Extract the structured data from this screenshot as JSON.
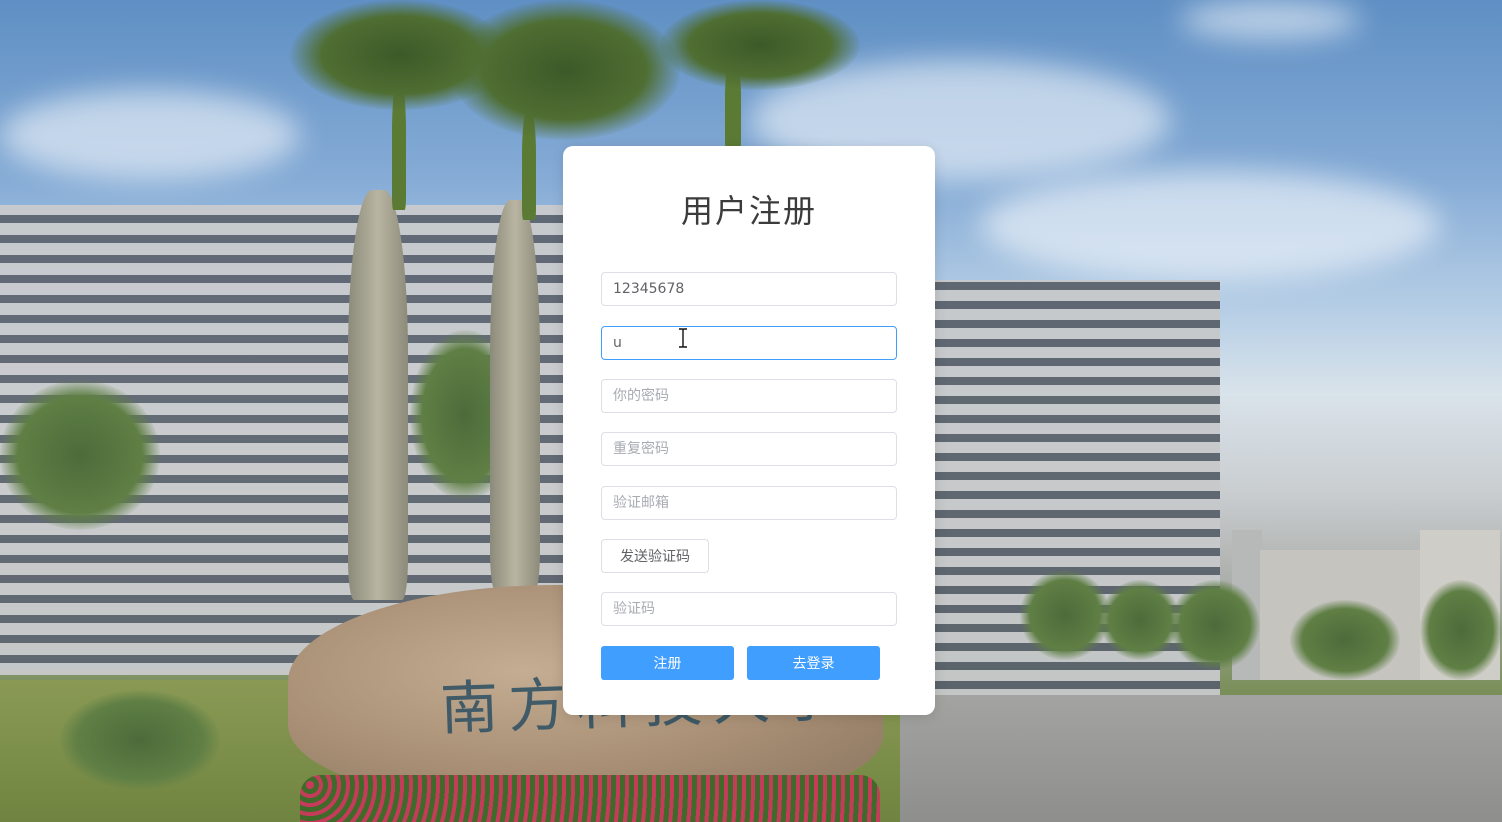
{
  "register_card": {
    "title": "用户注册",
    "student_id_value": "12345678",
    "username_value": "u",
    "password_placeholder": "你的密码",
    "repeat_password_placeholder": "重复密码",
    "email_placeholder": "验证邮箱",
    "send_code_label": "发送验证码",
    "code_placeholder": "验证码",
    "register_label": "注册",
    "goto_login_label": "去登录"
  },
  "background": {
    "stone_inscription": "南方科技大学"
  },
  "colors": {
    "primary": "#409eff",
    "focus_border": "#409eff",
    "card_background": "#ffffff"
  },
  "icons": {
    "cursor": "text-cursor-icon"
  }
}
